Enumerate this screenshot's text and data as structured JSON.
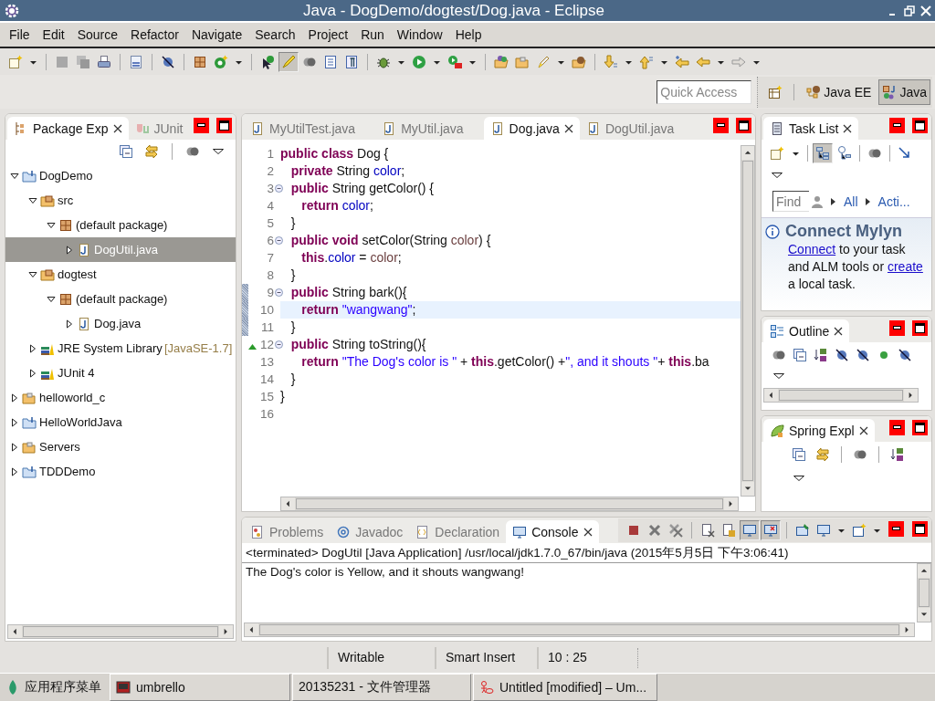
{
  "window": {
    "title": "Java - DogDemo/dogtest/Dog.java - Eclipse"
  },
  "menu": [
    "File",
    "Edit",
    "Source",
    "Refactor",
    "Navigate",
    "Search",
    "Project",
    "Run",
    "Window",
    "Help"
  ],
  "toolbar": [
    {
      "kind": "new"
    },
    {
      "kind": "caret"
    },
    {
      "kind": "sep"
    },
    {
      "kind": "save"
    },
    {
      "kind": "saveall"
    },
    {
      "kind": "print"
    },
    {
      "kind": "sep"
    },
    {
      "kind": "binary"
    },
    {
      "kind": "sep"
    },
    {
      "kind": "crossed"
    },
    {
      "kind": "sep"
    },
    {
      "kind": "package"
    },
    {
      "kind": "newclass"
    },
    {
      "kind": "caret"
    },
    {
      "kind": "sep"
    },
    {
      "kind": "opentype"
    },
    {
      "kind": "highlight",
      "pressed": true
    },
    {
      "kind": "dots",
      "pressed": false
    },
    {
      "kind": "list",
      "pressed": false
    },
    {
      "kind": "paragraph",
      "pressed": false
    },
    {
      "kind": "sep"
    },
    {
      "kind": "debug"
    },
    {
      "kind": "caret"
    },
    {
      "kind": "run"
    },
    {
      "kind": "caret"
    },
    {
      "kind": "runext"
    },
    {
      "kind": "caret"
    },
    {
      "kind": "sep"
    },
    {
      "kind": "openproject"
    },
    {
      "kind": "folder"
    },
    {
      "kind": "pen"
    },
    {
      "kind": "caret"
    },
    {
      "kind": "openresource"
    },
    {
      "kind": "sep"
    },
    {
      "kind": "down"
    },
    {
      "kind": "caret"
    },
    {
      "kind": "up"
    },
    {
      "kind": "caret"
    },
    {
      "kind": "laststar"
    },
    {
      "kind": "back"
    },
    {
      "kind": "caret"
    },
    {
      "kind": "forward"
    },
    {
      "kind": "caret"
    }
  ],
  "perspective_bar": {
    "quick_access": {
      "placeholder": "Quick Access"
    },
    "perspectives": [
      {
        "label": "Java EE",
        "kind": "javaee",
        "selected": false
      },
      {
        "label": "Java",
        "kind": "java",
        "selected": true
      }
    ]
  },
  "package_explorer": {
    "tabs": [
      {
        "label": "Package Exp",
        "kind": "packages",
        "selected": true
      },
      {
        "label": "JUnit",
        "kind": "junit",
        "selected": false
      }
    ],
    "toolbar": [
      {
        "kind": "collapse"
      },
      {
        "kind": "link"
      },
      {
        "kind": "sep"
      },
      {
        "kind": "dots"
      },
      {
        "kind": "menu"
      }
    ],
    "tree": [
      {
        "label": "DogDemo",
        "kind": "project",
        "expanded": true,
        "selected": false,
        "children": [
          {
            "label": "src",
            "kind": "srcfolder",
            "expanded": true,
            "selected": false,
            "children": [
              {
                "label": "(default package)",
                "kind": "package",
                "expanded": true,
                "selected": false,
                "children": [
                  {
                    "label": "DogUtil.java",
                    "kind": "javafile",
                    "expanded": false,
                    "selected": true
                  }
                ]
              }
            ]
          },
          {
            "label": "dogtest",
            "kind": "srcfolder",
            "expanded": true,
            "selected": false,
            "children": [
              {
                "label": "(default package)",
                "kind": "package",
                "expanded": true,
                "selected": false,
                "children": [
                  {
                    "label": "Dog.java",
                    "kind": "javafile",
                    "expanded": false,
                    "selected": false
                  }
                ]
              }
            ]
          },
          {
            "label": "JRE System Library",
            "decoration": "[JavaSE-1.7]",
            "kind": "library",
            "expanded": false,
            "selected": false
          },
          {
            "label": "JUnit 4",
            "kind": "library",
            "expanded": false,
            "selected": false
          }
        ]
      },
      {
        "label": "helloworld_c",
        "kind": "folder",
        "expanded": false,
        "selected": false
      },
      {
        "label": "HelloWorldJava",
        "kind": "project",
        "expanded": false,
        "selected": false
      },
      {
        "label": "Servers",
        "kind": "folder",
        "expanded": false,
        "selected": false
      },
      {
        "label": "TDDDemo",
        "kind": "project",
        "expanded": false,
        "selected": false
      }
    ]
  },
  "editor": {
    "tabs": [
      {
        "label": "MyUtilTest.java",
        "selected": false
      },
      {
        "label": "MyUtil.java",
        "selected": false
      },
      {
        "label": "Dog.java",
        "selected": true
      },
      {
        "label": "DogUtil.java",
        "selected": false
      }
    ],
    "lines": [
      {
        "number": "1",
        "fold": false,
        "override": false,
        "range": false,
        "current": false,
        "tokens": [
          {
            "kind": "kw",
            "text": "public class"
          },
          {
            "kind": "plain",
            "text": " Dog {"
          }
        ]
      },
      {
        "number": "2",
        "fold": false,
        "override": false,
        "range": false,
        "current": false,
        "tokens": [
          {
            "kind": "kw",
            "text": "   private"
          },
          {
            "kind": "plain",
            "text": " String "
          },
          {
            "kind": "field",
            "text": "color"
          },
          {
            "kind": "plain",
            "text": ";"
          }
        ]
      },
      {
        "number": "3",
        "fold": true,
        "override": false,
        "range": false,
        "current": false,
        "tokens": [
          {
            "kind": "kw",
            "text": "   public"
          },
          {
            "kind": "plain",
            "text": " String getColor() {"
          }
        ]
      },
      {
        "number": "4",
        "fold": false,
        "override": false,
        "range": false,
        "current": false,
        "tokens": [
          {
            "kind": "kw",
            "text": "      return"
          },
          {
            "kind": "field",
            "text": " color"
          },
          {
            "kind": "plain",
            "text": ";"
          }
        ]
      },
      {
        "number": "5",
        "fold": false,
        "override": false,
        "range": false,
        "current": false,
        "tokens": [
          {
            "kind": "plain",
            "text": "   }"
          }
        ]
      },
      {
        "number": "6",
        "fold": true,
        "override": false,
        "range": false,
        "current": false,
        "tokens": [
          {
            "kind": "kw",
            "text": "   public void"
          },
          {
            "kind": "plain",
            "text": " setColor(String "
          },
          {
            "kind": "param",
            "text": "color"
          },
          {
            "kind": "plain",
            "text": ") {"
          }
        ]
      },
      {
        "number": "7",
        "fold": false,
        "override": false,
        "range": false,
        "current": false,
        "tokens": [
          {
            "kind": "kw",
            "text": "      this"
          },
          {
            "kind": "plain",
            "text": "."
          },
          {
            "kind": "field",
            "text": "color"
          },
          {
            "kind": "plain",
            "text": " = "
          },
          {
            "kind": "param",
            "text": "color"
          },
          {
            "kind": "plain",
            "text": ";"
          }
        ]
      },
      {
        "number": "8",
        "fold": false,
        "override": false,
        "range": false,
        "current": false,
        "tokens": [
          {
            "kind": "plain",
            "text": "   }"
          }
        ]
      },
      {
        "number": "9",
        "fold": true,
        "override": false,
        "range": true,
        "current": false,
        "tokens": [
          {
            "kind": "kw",
            "text": "   public"
          },
          {
            "kind": "plain",
            "text": " String bark(){"
          }
        ]
      },
      {
        "number": "10",
        "fold": false,
        "override": false,
        "range": true,
        "current": true,
        "tokens": [
          {
            "kind": "kw",
            "text": "      return"
          },
          {
            "kind": "str",
            "text": " \"wangwang\""
          },
          {
            "kind": "plain",
            "text": ";"
          }
        ]
      },
      {
        "number": "11",
        "fold": false,
        "override": false,
        "range": true,
        "current": false,
        "tokens": [
          {
            "kind": "plain",
            "text": "   }"
          }
        ]
      },
      {
        "number": "12",
        "fold": true,
        "override": true,
        "range": false,
        "current": false,
        "tokens": [
          {
            "kind": "kw",
            "text": "   public"
          },
          {
            "kind": "plain",
            "text": " String toString(){"
          }
        ]
      },
      {
        "number": "13",
        "fold": false,
        "override": false,
        "range": false,
        "current": false,
        "tokens": [
          {
            "kind": "kw",
            "text": "      return"
          },
          {
            "kind": "str",
            "text": " \"The Dog's color is \""
          },
          {
            "kind": "plain",
            "text": " + "
          },
          {
            "kind": "kw",
            "text": "this"
          },
          {
            "kind": "plain",
            "text": ".getColor() +"
          },
          {
            "kind": "str",
            "text": "\", and it shouts \""
          },
          {
            "kind": "plain",
            "text": "+ "
          },
          {
            "kind": "kw",
            "text": "this"
          },
          {
            "kind": "plain",
            "text": ".ba"
          }
        ]
      },
      {
        "number": "14",
        "fold": false,
        "override": false,
        "range": false,
        "current": false,
        "tokens": [
          {
            "kind": "plain",
            "text": "   }"
          }
        ]
      },
      {
        "number": "15",
        "fold": false,
        "override": false,
        "range": false,
        "current": false,
        "tokens": [
          {
            "kind": "plain",
            "text": "}"
          }
        ]
      },
      {
        "number": "16",
        "fold": false,
        "override": false,
        "range": false,
        "current": false
      }
    ]
  },
  "task_list": {
    "tabs": [
      {
        "label": "Task List",
        "kind": "tasks",
        "selected": true
      }
    ],
    "toolbar": [
      {
        "kind": "new"
      },
      {
        "kind": "caret"
      },
      {
        "kind": "sep"
      },
      {
        "kind": "tree",
        "pressed": true
      },
      {
        "kind": "clocktree",
        "pressed": false
      },
      {
        "kind": "sep"
      },
      {
        "kind": "dots",
        "pressed": false
      },
      {
        "kind": "sep"
      },
      {
        "kind": "arrow"
      },
      {
        "kind": "menu"
      }
    ],
    "find": {
      "placeholder": "Find"
    },
    "filters": [
      "All",
      "Acti..."
    ],
    "connect": {
      "heading": "Connect Mylyn",
      "text": [
        {
          "text": "Connect",
          "link": true
        },
        {
          "text": " to your task and ALM tools or ",
          "link": false
        },
        {
          "text": "create",
          "link": true
        },
        {
          "text": " a local task.",
          "link": false
        }
      ]
    }
  },
  "outline": {
    "tabs": [
      {
        "label": "Outline",
        "kind": "outline",
        "selected": true
      }
    ],
    "toolbar": [
      {
        "kind": "dots"
      },
      {
        "kind": "collapse"
      },
      {
        "kind": "sort"
      },
      {
        "kind": "crossed"
      },
      {
        "kind": "crossed"
      },
      {
        "kind": "dot"
      },
      {
        "kind": "crossed"
      },
      {
        "kind": "menu"
      }
    ]
  },
  "spring_explorer": {
    "tabs": [
      {
        "label": "Spring Expl",
        "kind": "leaf",
        "selected": true
      }
    ],
    "toolbar": [
      {
        "kind": "collapse"
      },
      {
        "kind": "link"
      },
      {
        "kind": "sep"
      },
      {
        "kind": "dots"
      },
      {
        "kind": "sep"
      },
      {
        "kind": "sort"
      },
      {
        "kind": "menu"
      }
    ]
  },
  "console": {
    "tabs": [
      {
        "label": "Problems",
        "kind": "problems",
        "selected": false
      },
      {
        "label": "Javadoc",
        "kind": "at",
        "selected": false
      },
      {
        "label": "Declaration",
        "kind": "declaration",
        "selected": false
      },
      {
        "label": "Console",
        "kind": "monitor",
        "selected": true
      }
    ],
    "toolbar": [
      {
        "kind": "stop"
      },
      {
        "kind": "remove"
      },
      {
        "kind": "removeall"
      },
      {
        "kind": "sep"
      },
      {
        "kind": "clear"
      },
      {
        "kind": "lock",
        "pressed": false
      },
      {
        "kind": "monitor",
        "pressed": true
      },
      {
        "kind": "monitorx",
        "pressed": true
      },
      {
        "kind": "sep"
      },
      {
        "kind": "pin",
        "pressed": false
      },
      {
        "kind": "monitor"
      },
      {
        "kind": "caret"
      },
      {
        "kind": "newwin"
      },
      {
        "kind": "caret"
      }
    ],
    "process": "<terminated> DogUtil [Java Application] /usr/local/jdk1.7.0_67/bin/java (2015年5月5日 下午3:06:41)",
    "output": "The Dog's color is Yellow, and it shouts wangwang!"
  },
  "status_bar": [
    "Writable",
    "Smart Insert",
    "10 : 25"
  ],
  "taskbar": {
    "start": "应用程序菜单",
    "tasks": [
      {
        "label": "umbrello",
        "kind": "app"
      },
      {
        "label": "20135231 - 文件管理器",
        "kind": "folder"
      },
      {
        "label": "Untitled [modified] – Um...",
        "kind": "uml"
      }
    ]
  }
}
